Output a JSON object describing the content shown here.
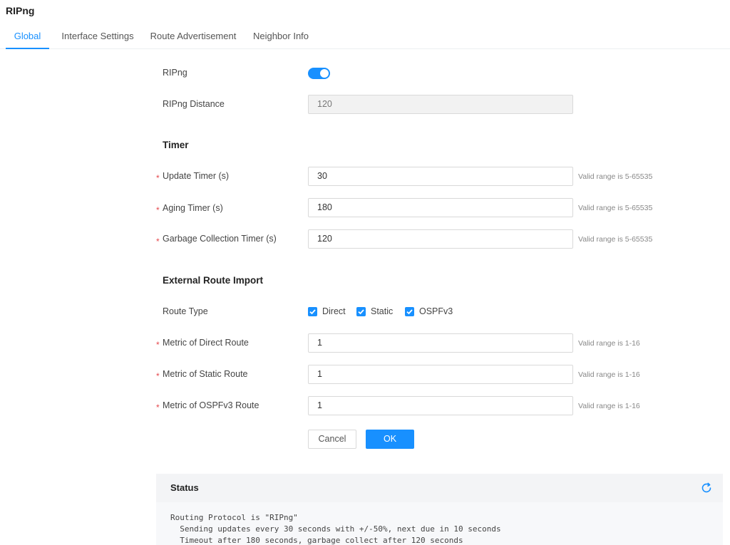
{
  "page": {
    "title": "RIPng"
  },
  "tabs": [
    {
      "label": "Global",
      "active": true
    },
    {
      "label": "Interface Settings",
      "active": false
    },
    {
      "label": "Route Advertisement",
      "active": false
    },
    {
      "label": "Neighbor Info",
      "active": false
    }
  ],
  "form": {
    "ripng_label": "RIPng",
    "ripng_enabled": true,
    "distance_label": "RIPng Distance",
    "distance_value": "120",
    "timer_section": "Timer",
    "update_timer_label": "Update Timer (s)",
    "update_timer_value": "30",
    "aging_timer_label": "Aging Timer (s)",
    "aging_timer_value": "180",
    "garbage_timer_label": "Garbage Collection Timer (s)",
    "garbage_timer_value": "120",
    "timer_hint": "Valid range is 5-65535",
    "import_section": "External Route Import",
    "route_type_label": "Route Type",
    "route_types": [
      {
        "label": "Direct",
        "checked": true
      },
      {
        "label": "Static",
        "checked": true
      },
      {
        "label": "OSPFv3",
        "checked": true
      }
    ],
    "metric_direct_label": "Metric of Direct Route",
    "metric_direct_value": "1",
    "metric_static_label": "Metric of Static Route",
    "metric_static_value": "1",
    "metric_ospf_label": "Metric of OSPFv3 Route",
    "metric_ospf_value": "1",
    "metric_hint": "Valid range is 1-16",
    "required_mark": "*"
  },
  "buttons": {
    "cancel": "Cancel",
    "ok": "OK"
  },
  "status": {
    "title": "Status",
    "lines": "Routing Protocol is \"RIPng\"\n  Sending updates every 30 seconds with +/-50%, next due in 10 seconds\n  Timeout after 180 seconds, garbage collect after 120 seconds"
  },
  "colors": {
    "accent": "#1890ff",
    "required": "#e5484d"
  },
  "icons": {
    "refresh": "refresh-icon",
    "checkmark": "check-icon"
  }
}
